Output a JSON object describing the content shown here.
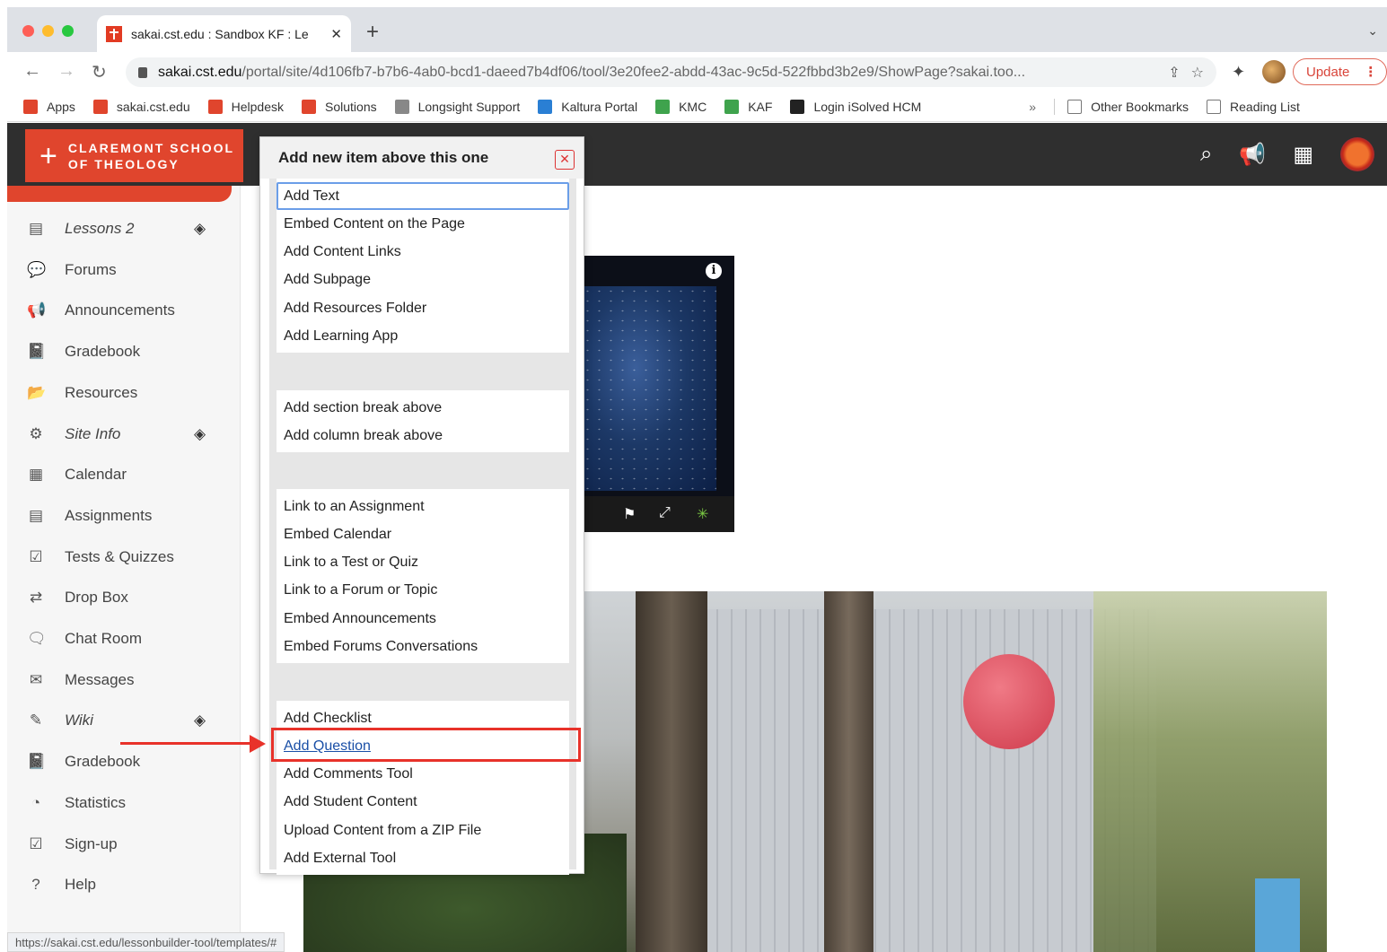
{
  "browser": {
    "tab_title": "sakai.cst.edu : Sandbox KF : Le",
    "tab_close": "✕",
    "new_tab": "+",
    "tab_menu": "⌄",
    "url_host": "sakai.cst.edu",
    "url_path": "/portal/site/4d106fb7-b7b6-4ab0-bcd1-daeed7b4df06/tool/3e20fee2-abdd-43ac-9c5d-522fbbd3b2e9/ShowPage?sakai.too...",
    "update_label": "Update",
    "update_dots": "⋮",
    "bookmarks": [
      {
        "label": "Apps",
        "color": "#e0452d"
      },
      {
        "label": "sakai.cst.edu",
        "color": "#e0452d"
      },
      {
        "label": "Helpdesk",
        "color": "#e0452d"
      },
      {
        "label": "Solutions",
        "color": "#e0452d"
      },
      {
        "label": "Longsight Support",
        "color": "#888888"
      },
      {
        "label": "Kaltura Portal",
        "color": "#2a7fd4"
      },
      {
        "label": "KMC",
        "color": "#3fa34d"
      },
      {
        "label": "KAF",
        "color": "#3fa34d"
      },
      {
        "label": "Login iSolved HCM",
        "color": "#222222"
      }
    ],
    "bookmarks_more": "»",
    "other_bookmarks": "Other Bookmarks",
    "reading_list": "Reading List",
    "status_url": "https://sakai.cst.edu/lessonbuilder-tool/templates/#"
  },
  "header": {
    "logo_cross": "+",
    "logo_line1": "CLAREMONT SCHOOL",
    "logo_line2": "OF THEOLOGY"
  },
  "sidebar": {
    "items": [
      {
        "label": "Lessons 2",
        "icon": "lessons-icon",
        "glyph": "▤",
        "hidden": true
      },
      {
        "label": "Forums",
        "icon": "forums-icon",
        "glyph": "💬",
        "hidden": false
      },
      {
        "label": "Announcements",
        "icon": "megaphone-icon",
        "glyph": "📢",
        "hidden": false
      },
      {
        "label": "Gradebook",
        "icon": "gradebook-icon",
        "glyph": "📓",
        "hidden": false
      },
      {
        "label": "Resources",
        "icon": "folder-icon",
        "glyph": "📂",
        "hidden": false
      },
      {
        "label": "Site Info",
        "icon": "gear-icon",
        "glyph": "⚙",
        "hidden": true
      },
      {
        "label": "Calendar",
        "icon": "calendar-icon",
        "glyph": "▦",
        "hidden": false
      },
      {
        "label": "Assignments",
        "icon": "assignment-icon",
        "glyph": "▤",
        "hidden": false
      },
      {
        "label": "Tests & Quizzes",
        "icon": "quiz-icon",
        "glyph": "☑",
        "hidden": false
      },
      {
        "label": "Drop Box",
        "icon": "dropbox-icon",
        "glyph": "⇄",
        "hidden": false
      },
      {
        "label": "Chat Room",
        "icon": "chat-icon",
        "glyph": "🗨",
        "hidden": false
      },
      {
        "label": "Messages",
        "icon": "inbox-icon",
        "glyph": "✉",
        "hidden": false
      },
      {
        "label": "Wiki",
        "icon": "wiki-icon",
        "glyph": "✎",
        "hidden": true
      },
      {
        "label": "Gradebook",
        "icon": "gradebook-icon",
        "glyph": "📓",
        "hidden": false
      },
      {
        "label": "Statistics",
        "icon": "pie-chart-icon",
        "glyph": "◔",
        "hidden": false
      },
      {
        "label": "Sign-up",
        "icon": "signup-icon",
        "glyph": "☑",
        "hidden": false
      },
      {
        "label": "Help",
        "icon": "help-icon",
        "glyph": "?",
        "hidden": false
      }
    ],
    "eye_glyph": "◈"
  },
  "menu": {
    "title": "Add new item above this one",
    "close": "✕",
    "groups": [
      [
        "Add Text",
        "Embed Content on the Page",
        "Add Content Links",
        "Add Subpage",
        "Add Resources Folder",
        "Add Learning App"
      ],
      [
        "Add section break above",
        "Add column break above"
      ],
      [
        "Link to an Assignment",
        "Embed Calendar",
        "Link to a Test or Quiz",
        "Link to a Forum or Topic",
        "Embed Announcements",
        "Embed Forums Conversations"
      ],
      [
        "Add Checklist",
        "Add Question",
        "Add Comments Tool",
        "Add Student Content",
        "Upload Content from a ZIP File",
        "Add External Tool"
      ]
    ]
  },
  "video": {
    "info": "i"
  },
  "colors": {
    "brand": "#e0452d",
    "highlight": "#e8322a",
    "topbar": "#2f2f2f"
  }
}
